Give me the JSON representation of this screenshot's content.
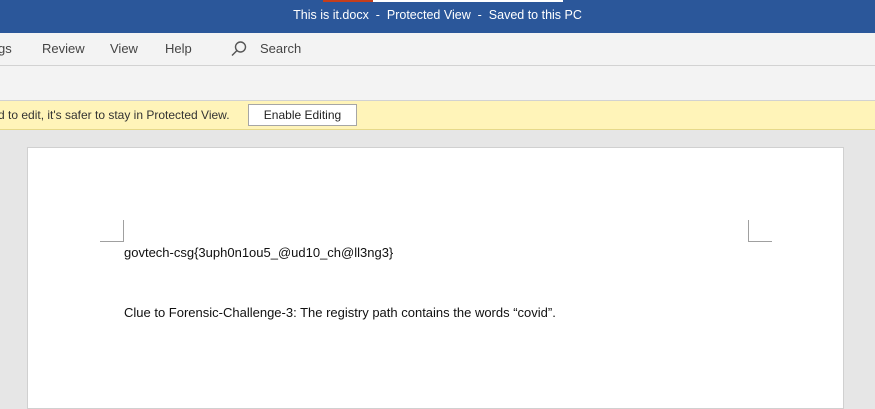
{
  "window": {
    "title": "This is it.docx  -  Protected View  -  Saved to this PC"
  },
  "ribbon": {
    "tabs": [
      "gs",
      "Review",
      "View",
      "Help"
    ],
    "search_label": "Search"
  },
  "message_bar": {
    "text": "d to edit, it's safer to stay in Protected View.",
    "button_label": "Enable Editing",
    "background": "#fff4b9"
  },
  "document": {
    "lines": [
      "govtech-csg{3uph0n1ou5_@ud10_ch@ll3ng3}",
      "Clue to Forensic-Challenge-3: The registry path contains the words “covid”."
    ]
  },
  "colors": {
    "titlebar": "#2b579a",
    "ribbon": "#f3f3f3",
    "canvas": "#e6e6e6"
  },
  "icons": {
    "search": "search-icon"
  }
}
